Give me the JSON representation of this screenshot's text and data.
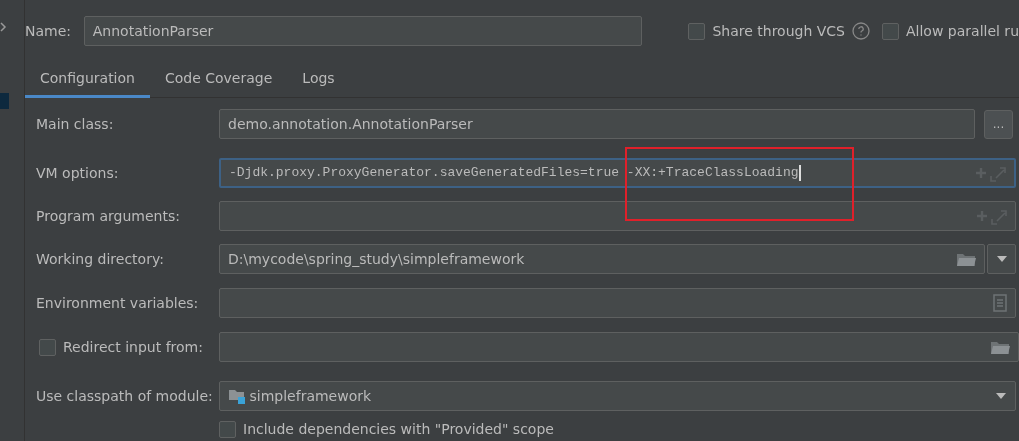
{
  "name_field": {
    "label": "Name:",
    "value": "AnnotationParser"
  },
  "options": [
    {
      "label": "Share through VCS",
      "checked": false,
      "help": true
    },
    {
      "label": "Allow parallel ru",
      "checked": false
    }
  ],
  "tabs": [
    {
      "label": "Configuration",
      "selected": true
    },
    {
      "label": "Code Coverage",
      "selected": false
    },
    {
      "label": "Logs",
      "selected": false
    }
  ],
  "form": [
    {
      "kind": "class",
      "label": "Main class:",
      "value": "demo.annotation.AnnotationParser",
      "button": "..."
    },
    {
      "kind": "expandable",
      "label": "VM options:",
      "value": "-Djdk.proxy.ProxyGenerator.saveGeneratedFiles=true -XX:+TraceClassLoading",
      "focused": true,
      "annotated": true
    },
    {
      "kind": "expandable",
      "label": "Program arguments:"
    },
    {
      "kind": "directory",
      "label": "Working directory:",
      "value": "D:\\mycode\\spring_study\\simpleframework"
    },
    {
      "kind": "env",
      "label": "Environment variables:"
    },
    {
      "kind": "redirect",
      "label": "Redirect input from:",
      "checked": false
    },
    {
      "kind": "module",
      "label": "Use classpath of module:",
      "value": "simpleframework"
    },
    {
      "kind": "checkbox",
      "label": "Include dependencies with \"Provided\" scope",
      "checked": false
    }
  ]
}
